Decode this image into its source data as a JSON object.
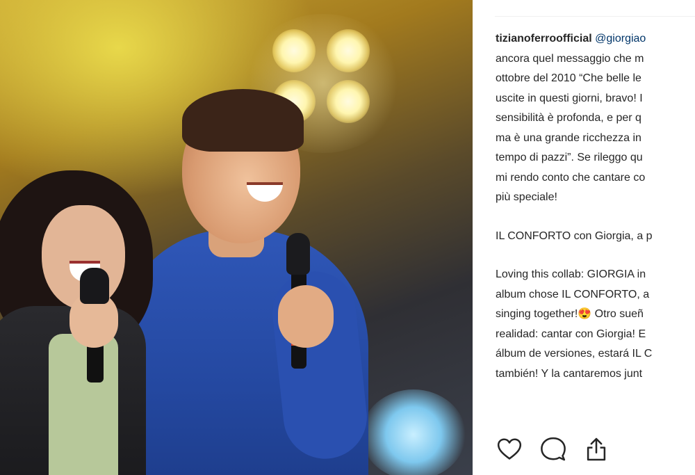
{
  "post": {
    "image_alt": "photo",
    "caption": {
      "username": "tizianoferroofficial",
      "mention": "@giorgiao",
      "lines_p1": [
        "ancora quel messaggio che m",
        "ottobre del 2010 “Che belle le",
        "uscite in questi giorni, bravo! I",
        "sensibilità è profonda, e per q",
        "ma è una grande ricchezza in",
        "tempo di pazzi”. Se rileggo qu",
        "mi rendo conto che cantare co",
        "più speciale!"
      ],
      "line_p2": "IL CONFORTO con Giorgia, a p",
      "lines_p3": [
        "Loving this collab: GIORGIA in",
        "album chose IL CONFORTO, a",
        "singing together!😍 Otro sueñ",
        "realidad: cantar con Giorgia! E",
        "álbum de versiones, estará IL C",
        "también! Y la cantaremos junt"
      ]
    }
  },
  "actions": {
    "like": "heart-icon",
    "comment": "comment-icon",
    "share": "share-icon"
  }
}
